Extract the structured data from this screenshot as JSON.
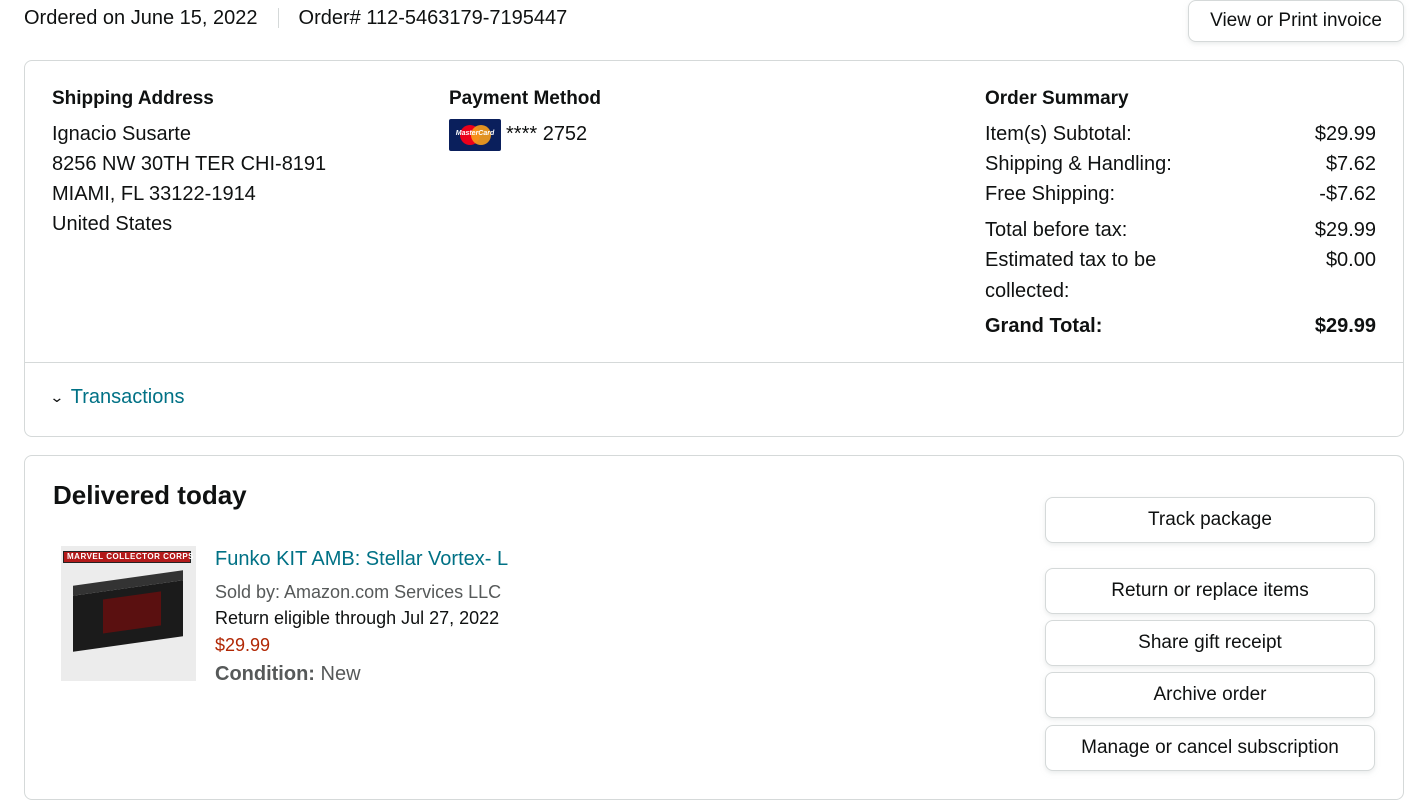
{
  "order": {
    "ordered_on": "Ordered on June 15, 2022",
    "order_number": "Order# 112-5463179-7195447",
    "invoice_button": "View or Print invoice"
  },
  "shipping": {
    "title": "Shipping Address",
    "lines": [
      "Ignacio Susarte",
      "8256 NW 30TH TER CHI-8191",
      "MIAMI, FL 33122-1914",
      "United States"
    ]
  },
  "payment": {
    "title": "Payment Method",
    "card_brand_text": "MasterCard",
    "card_brand_icon": "mastercard-icon",
    "card_number": "**** 2752"
  },
  "summary": {
    "title": "Order Summary",
    "rows": [
      {
        "label": "Item(s) Subtotal:",
        "value": "$29.99"
      },
      {
        "label": "Shipping & Handling:",
        "value": "$7.62"
      },
      {
        "label": "Free Shipping:",
        "value": "-$7.62"
      },
      {
        "label": "Total before tax:",
        "value": "$29.99"
      },
      {
        "label": "Estimated tax to be",
        "label2": "collected:",
        "value": "$0.00"
      },
      {
        "label": "Grand Total:",
        "value": "$29.99"
      }
    ]
  },
  "transactions": {
    "label": "Transactions",
    "icon": "chevron-down-icon"
  },
  "shipment": {
    "status": "Delivered today",
    "product": {
      "title": "Funko KIT AMB: Stellar Vortex- L",
      "sold_by": "Sold by: Amazon.com Services LLC",
      "return_eligible": "Return eligible through Jul 27, 2022",
      "price": "$29.99",
      "condition_label": "Condition:",
      "condition_value": "New",
      "image_header": "MARVEL COLLECTOR CORPS"
    },
    "actions": [
      "Track package",
      "Return or replace items",
      "Share gift receipt",
      "Archive order",
      "Manage or cancel subscription"
    ]
  },
  "colors": {
    "link": "#007185",
    "price": "#b12704",
    "border": "#d5d9d9",
    "text": "#0f1111",
    "muted": "#565959"
  }
}
